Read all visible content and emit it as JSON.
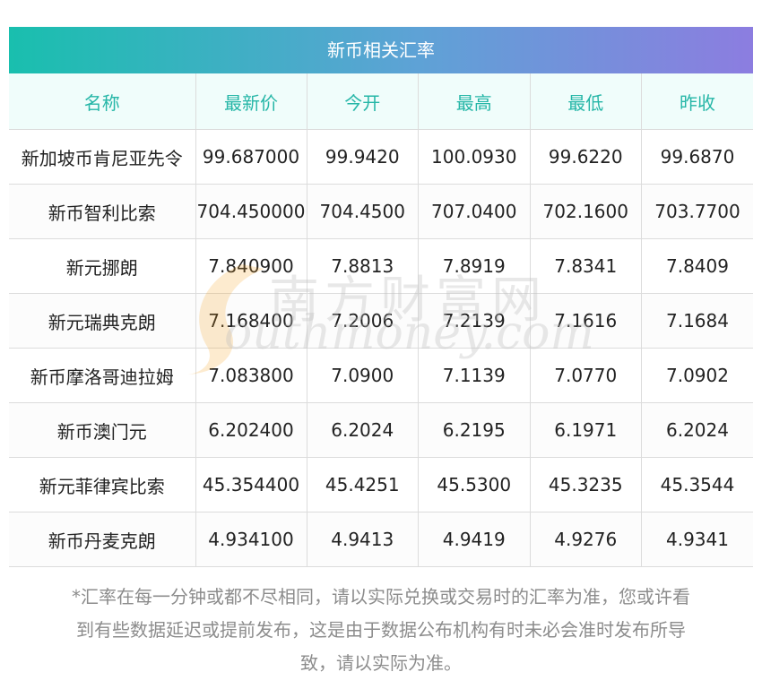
{
  "title": "新币相关汇率",
  "columns": [
    "名称",
    "最新价",
    "今开",
    "最高",
    "最低",
    "昨收"
  ],
  "rows": [
    [
      "新加坡币肯尼亚先令",
      "99.687000",
      "99.9420",
      "100.0930",
      "99.6220",
      "99.6870"
    ],
    [
      "新币智利比索",
      "704.450000",
      "704.4500",
      "707.0400",
      "702.1600",
      "703.7700"
    ],
    [
      "新元挪朗",
      "7.840900",
      "7.8813",
      "7.8919",
      "7.8341",
      "7.8409"
    ],
    [
      "新元瑞典克朗",
      "7.168400",
      "7.2006",
      "7.2139",
      "7.1616",
      "7.1684"
    ],
    [
      "新币摩洛哥迪拉姆",
      "7.083800",
      "7.0900",
      "7.1139",
      "7.0770",
      "7.0902"
    ],
    [
      "新币澳门元",
      "6.202400",
      "6.2024",
      "6.2195",
      "6.1971",
      "6.2024"
    ],
    [
      "新元菲律宾比索",
      "45.354400",
      "45.4251",
      "45.5300",
      "45.3235",
      "45.3544"
    ],
    [
      "新币丹麦克朗",
      "4.934100",
      "4.9413",
      "4.9419",
      "4.9276",
      "4.9341"
    ]
  ],
  "note_lines": [
    "*汇率在每一分钟或都不尽相同，请以实际兑换或交易时的汇率为准，您或许看",
    "到有些数据延迟或提前发布，这是由于数据公布机构有时未必会准时发布所导",
    "致，请以实际为准。"
  ],
  "watermark": {
    "cn": "南方财富网",
    "en": "outhmoney.com"
  },
  "colors": {
    "header_text": "#25b6a7",
    "header_bg": "#f0fdfb",
    "title_gradient_start": "#19bfae",
    "title_gradient_end": "#8c7de0",
    "swoosh": "#f5a623"
  }
}
